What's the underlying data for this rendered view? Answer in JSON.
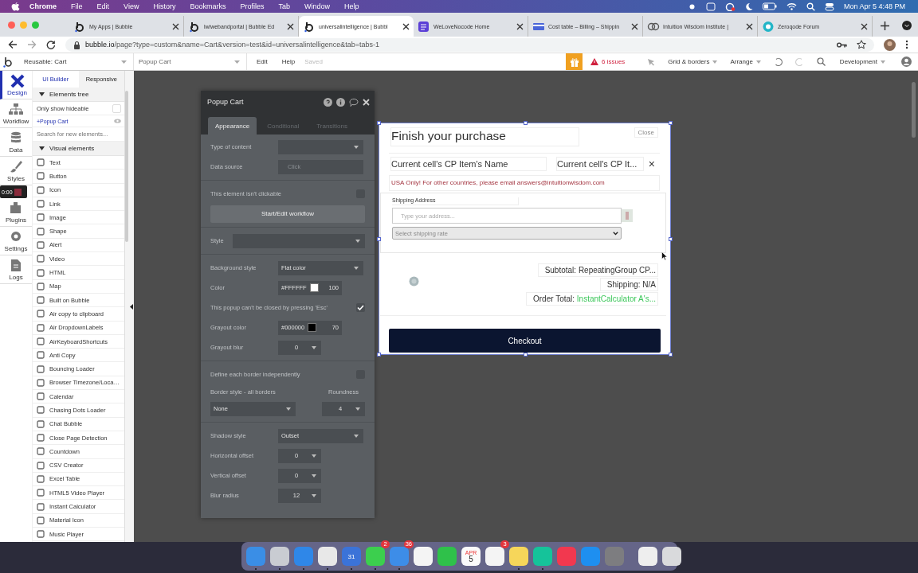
{
  "menu_bar": {
    "items": [
      "Chrome",
      "File",
      "Edit",
      "View",
      "History",
      "Bookmarks",
      "Profiles",
      "Tab",
      "Window",
      "Help"
    ],
    "clock": "Mon Apr 5  4:48 PM"
  },
  "browser_tabs": [
    {
      "title": "My Apps | Bubble",
      "selected": false,
      "kind": "bubble"
    },
    {
      "title": "lwiwebandportal | Bubble Ed",
      "selected": false,
      "kind": "bubble"
    },
    {
      "title": "universalintelligence | Bubbl",
      "selected": true,
      "kind": "bubble"
    },
    {
      "title": "WeLoveNocode Home",
      "selected": false,
      "kind": "square"
    },
    {
      "title": "Cost table – Billing – Shippin",
      "selected": false,
      "kind": "card"
    },
    {
      "title": "Intuition Wisdom Institute |",
      "selected": false,
      "kind": "rings"
    },
    {
      "title": "Zeroqode Forum",
      "selected": false,
      "kind": "circle"
    }
  ],
  "address_bar": {
    "host": "bubble.io",
    "path": "/page?type=custom&name=Cart&version=test&id=universalintelligence&tab=tabs-1"
  },
  "editor_toolbar": {
    "page_select": "Reusable: Cart",
    "element_select": "Popup Cart",
    "menus": [
      "Edit",
      "Help"
    ],
    "save_state": "Saved",
    "issues": "6 issues",
    "grid": "Grid & borders",
    "arrange": "Arrange",
    "version": "Development"
  },
  "side_rail": [
    {
      "label": "Design",
      "selected": true
    },
    {
      "label": "Workflow",
      "selected": false
    },
    {
      "label": "Data",
      "selected": false
    },
    {
      "label": "Styles",
      "selected": false
    },
    {
      "label": "Plugins",
      "selected": false
    },
    {
      "label": "Settings",
      "selected": false
    },
    {
      "label": "Logs",
      "selected": false
    }
  ],
  "recorder": {
    "time": "0:00"
  },
  "builder_panel": {
    "tabs": [
      {
        "label": "UI Builder",
        "selected": true
      },
      {
        "label": "Responsive",
        "selected": false
      }
    ],
    "tree_header": "Elements tree",
    "hideable": {
      "label": "Only show hideable",
      "checked": false
    },
    "root_element": "+Popup Cart",
    "search": {
      "placeholder": "Search for new elements..."
    },
    "section": "Visual elements",
    "elements": [
      "Text",
      "Button",
      "Icon",
      "Link",
      "Image",
      "Shape",
      "Alert",
      "Video",
      "HTML",
      "Map",
      "Built on Bubble",
      "Air copy to clipboard",
      "Air DropdownLabels",
      "AirKeyboardShortcuts",
      "Anti Copy",
      "Bouncing Loader",
      "Browser Timezone/Loca…",
      "Calendar",
      "Chasing Dots Loader",
      "Chat Bubble",
      "Close Page Detection",
      "Countdown",
      "CSV Creator",
      "Excel Table",
      "HTML5 Video Player",
      "Instant Calculator",
      "Material Icon",
      "Music Player"
    ]
  },
  "property_editor": {
    "title": "Popup Cart",
    "tabs": [
      {
        "label": "Appearance",
        "selected": true
      },
      {
        "label": "Conditional",
        "selected": false
      },
      {
        "label": "Transitions",
        "selected": false
      }
    ],
    "rows": [
      {
        "kind": "select",
        "label": "Type of content"
      },
      {
        "kind": "input",
        "label": "Data source",
        "placeholder": "Click"
      },
      {
        "kind": "sep"
      },
      {
        "kind": "check",
        "label": "This element isn't clickable",
        "checked": false
      },
      {
        "kind": "button",
        "label": "Start/Edit workflow"
      },
      {
        "kind": "sep"
      },
      {
        "kind": "wide-select",
        "label": "Style"
      },
      {
        "kind": "sep"
      },
      {
        "kind": "select",
        "label": "Background style",
        "value": "Flat color"
      },
      {
        "kind": "color",
        "label": "Color",
        "value": "#FFFFFF",
        "color": "#ffffff",
        "opacity": "100"
      },
      {
        "kind": "check",
        "label": "This popup can't be closed by pressing 'Esc'",
        "checked": true
      },
      {
        "kind": "color",
        "label": "Grayout color",
        "value": "#000000",
        "color": "#000000",
        "opacity": "70"
      },
      {
        "kind": "number",
        "label": "Grayout blur",
        "value": "0"
      },
      {
        "kind": "sep"
      },
      {
        "kind": "check",
        "label": "Define each border independently",
        "checked": false
      },
      {
        "kind": "pair",
        "label": "Border style - all borders",
        "value": "None",
        "label_2": "Roundness",
        "value_2": "4"
      },
      {
        "kind": "sep"
      },
      {
        "kind": "select",
        "label": "Shadow style",
        "value": "Outset"
      },
      {
        "kind": "number",
        "label": "Horizontal offset",
        "value": "0"
      },
      {
        "kind": "number",
        "label": "Vertical offset",
        "value": "0"
      },
      {
        "kind": "number",
        "label": "Blur radius",
        "value": "12"
      }
    ]
  },
  "popup": {
    "title": "Finish your purchase",
    "close": "Close",
    "item_name": "Current cell's CP Item's Name",
    "item_price": "Current cell's CP It...",
    "remove": "×",
    "notice": "USA Only! For other countries, please email answers@intuitionwisdom.com",
    "shipping_label": "Shipping Address",
    "address": {
      "placeholder": "Type your address..."
    },
    "rate": {
      "placeholder": "Select shipping rate"
    },
    "subtotal": "Subtotal: RepeatingGroup CP...",
    "shipping": "Shipping: N/A",
    "total_label": "Order Total: ",
    "total_value": "InstantCalculator A's...",
    "checkout": "Checkout"
  },
  "dock": [
    {
      "color": "#3a8ee6",
      "running": true
    },
    {
      "color": "#c9ccd2",
      "running": true
    },
    {
      "color": "#2f87e8",
      "running": true
    },
    {
      "color": "#e8e8e8",
      "running": true
    },
    {
      "color": "#3b73d8",
      "running": true,
      "label": "31"
    },
    {
      "color": "#3ccf4e",
      "running": true,
      "badge": "2"
    },
    {
      "color": "#3d8de8",
      "running": true,
      "badge": "36"
    },
    {
      "color": "#f4f4f4",
      "running": false
    },
    {
      "color": "#2fc14a",
      "running": false
    },
    {
      "color": "#fafafa",
      "running": false,
      "month": "APR",
      "day": "5"
    },
    {
      "color": "#f4f4f4",
      "running": false,
      "badge": "3"
    },
    {
      "color": "#f6d65a",
      "running": true
    },
    {
      "color": "#15c39a",
      "running": true
    },
    {
      "color": "#f2384f",
      "running": false
    },
    {
      "color": "#1e8ff0",
      "running": false
    },
    {
      "color": "#7d7d80",
      "running": false
    },
    {
      "color": "#eeeeee",
      "running": false,
      "kind": "after-divider"
    },
    {
      "color": "#d9dadc",
      "running": false
    }
  ]
}
